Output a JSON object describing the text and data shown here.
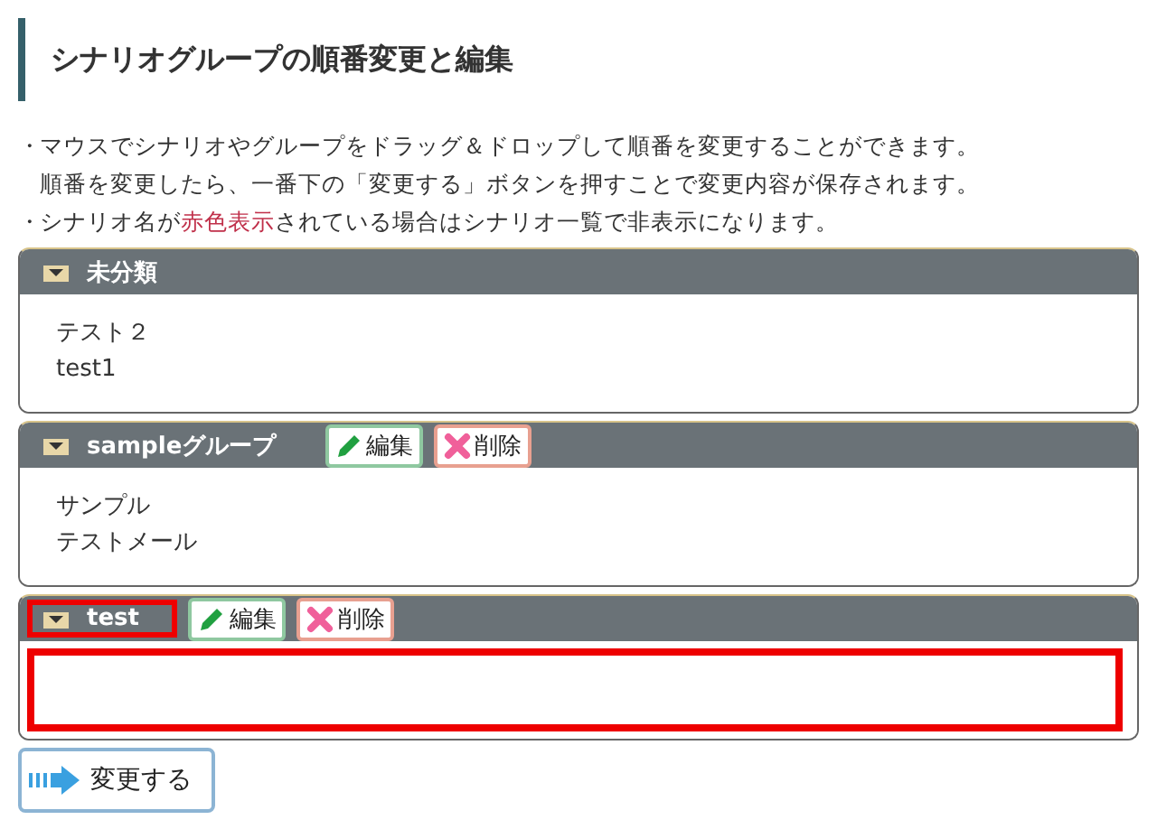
{
  "title": "シナリオグループの順番変更と編集",
  "notes": [
    {
      "bullet": "・",
      "text": "マウスでシナリオやグループをドラッグ＆ドロップして順番を変更することができます。"
    },
    {
      "text": "順番を変更したら、一番下の「変更する」ボタンを押すことで変更内容が保存されます。"
    },
    {
      "bullet": "・",
      "text": "シナリオ名が**赤色表示**されている場合はシナリオ一覧で非表示になります。"
    }
  ],
  "groups": [
    {
      "name": "未分類",
      "highlighted": false,
      "items": [
        "テスト２",
        "test1"
      ]
    },
    {
      "name": "sampleグループ",
      "edit_label": "編集",
      "delete_label": "削除",
      "highlighted": false,
      "items": [
        "サンプル",
        "テストメール"
      ]
    },
    {
      "name": "test",
      "edit_label": "編集",
      "delete_label": "削除",
      "highlighted": true
    }
  ],
  "submit_button": "変更する"
}
